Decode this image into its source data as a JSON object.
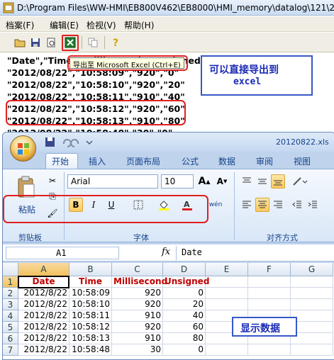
{
  "viewer": {
    "title": "D:\\Program Files\\WW-HMI\\EB800V462\\EB8000\\HMI_memory\\datalog\\121\\2",
    "menu": [
      "档案(F)",
      "编辑(E)",
      "检视(V)",
      "帮助(H)"
    ],
    "tooltip": "导出至 Microsoft Excel (Ctrl+E)",
    "lines": [
      "\"Date\",\"Time\",\"Millisecond\",\"Unsigned\"",
      "\"2012/08/22\",\"10:58:09\",\"920\",\"0\"",
      "\"2012/08/22\",\"10:58:10\",\"920\",\"20\"",
      "\"2012/08/22\",\"10:58:11\",\"910\",\"40\"",
      "\"2012/08/22\",\"10:58:12\",\"920\",\"60\"",
      "\"2012/08/22\",\"10:58:13\",\"910\",\"80\"",
      "\"2012/08/22\",\"10:58:48\",\"30\",\"0\""
    ],
    "note": {
      "line1": "可以直接导出到",
      "line2": "excel"
    }
  },
  "excel": {
    "filename": "20120822.xls",
    "tabs": [
      "开始",
      "插入",
      "页面布局",
      "公式",
      "数据",
      "审阅",
      "视图"
    ],
    "groups": {
      "clipboard": "剪贴板",
      "font": "字体",
      "alignment": "对齐方式"
    },
    "paste_label": "粘贴",
    "font_name": "Arial",
    "font_size": "10",
    "bold": "B",
    "italic": "I",
    "underline": "U",
    "name_box": "A1",
    "fx": "fx",
    "formula_value": "Date",
    "columns": [
      "A",
      "B",
      "C",
      "D",
      "E",
      "F",
      "G"
    ],
    "rows": [
      [
        "Date",
        "Time",
        "Millisecond",
        "Unsigned"
      ],
      [
        "2012/8/22",
        "10:58:09",
        "920",
        "0"
      ],
      [
        "2012/8/22",
        "10:58:10",
        "920",
        "20"
      ],
      [
        "2012/8/22",
        "10:58:11",
        "910",
        "40"
      ],
      [
        "2012/8/22",
        "10:58:12",
        "920",
        "60"
      ],
      [
        "2012/8/22",
        "10:58:13",
        "910",
        "80"
      ],
      [
        "2012/8/22",
        "10:58:48",
        "30",
        "0"
      ]
    ],
    "note": "显示数据"
  }
}
